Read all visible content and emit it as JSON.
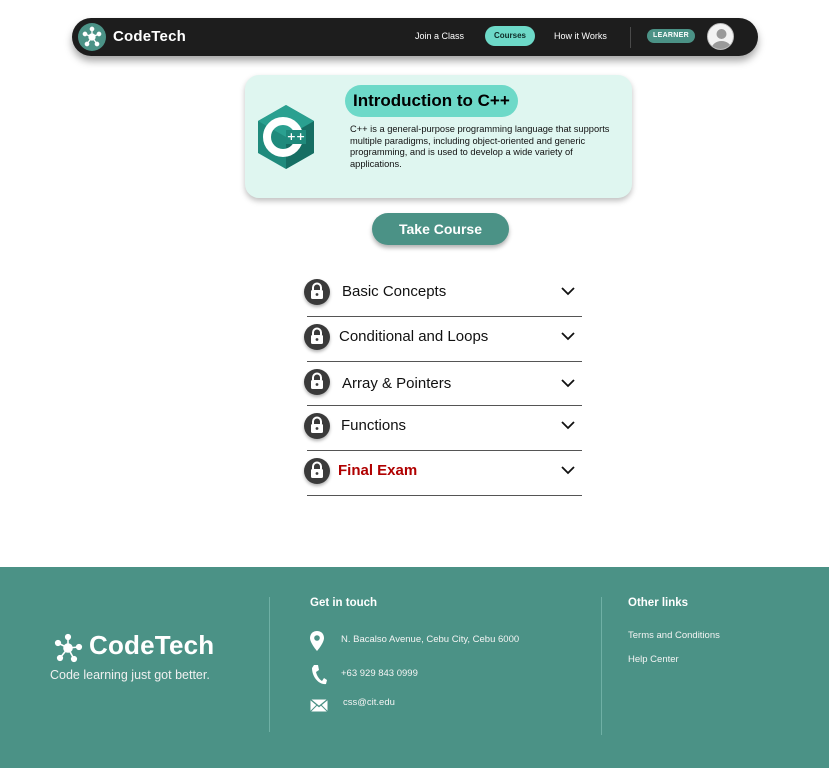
{
  "nav": {
    "brand": "CodeTech",
    "links": [
      "Join a Class",
      "Courses",
      "How it Works"
    ],
    "role_badge": "LEARNER",
    "active_link": "Courses"
  },
  "course": {
    "title": "Introduction to C++",
    "description": "C++ is a general-purpose programming language that supports multiple paradigms, including object-oriented and generic programming, and is used to develop a wide variety of applications.",
    "cta": "Take Course"
  },
  "modules": [
    {
      "label": "Basic Concepts",
      "locked": true
    },
    {
      "label": "Conditional and Loops",
      "locked": true
    },
    {
      "label": "Array & Pointers",
      "locked": true
    },
    {
      "label": "Functions",
      "locked": true
    },
    {
      "label": "Final Exam",
      "locked": true
    }
  ],
  "footer": {
    "brand": "CodeTech",
    "tagline": "Code learning just got better.",
    "contact_heading": "Get in touch",
    "address": "N. Bacalso Avenue, Cebu City, Cebu 6000",
    "phone": "+63 929 843 0999",
    "email": "css@cit.edu",
    "links_heading": "Other links",
    "links": [
      "Terms and Conditions",
      "Help Center"
    ]
  },
  "colors": {
    "accent": "#4b9286",
    "highlight": "#6dd9c8",
    "card_bg": "#dff6f0",
    "nav_bg": "#1d1d1d",
    "exam_red": "#b00000"
  },
  "icons": [
    "network-logo-icon",
    "cpp-logo-icon",
    "lock-icon",
    "chevron-down-icon",
    "location-pin-icon",
    "phone-icon",
    "mail-icon",
    "user-avatar-icon"
  ]
}
